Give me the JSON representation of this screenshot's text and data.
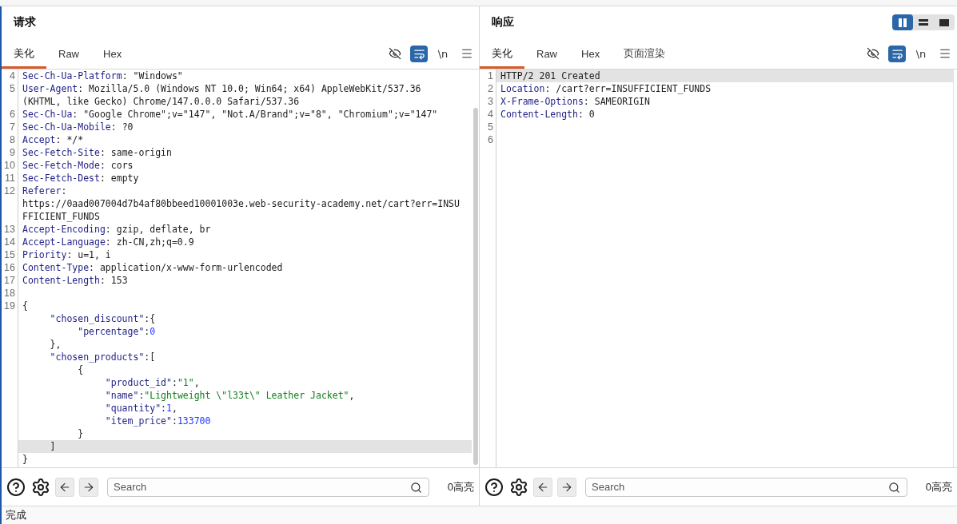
{
  "request": {
    "title": "请求",
    "tabs": [
      {
        "label": "美化",
        "selected": true
      },
      {
        "label": "Raw",
        "selected": false
      },
      {
        "label": "Hex",
        "selected": false
      }
    ],
    "view_toggles": [
      {
        "kind": "hide",
        "selected": false
      },
      {
        "kind": "wrap",
        "selected": true
      },
      {
        "kind": "newline",
        "label": "\\n",
        "selected": false
      }
    ],
    "lines": [
      {
        "number": "4",
        "rows": [
          {
            "current": false,
            "tokens": [
              {
                "kind": "key",
                "text": "Sec-Ch-Ua-Platform"
              },
              {
                "kind": "plain",
                "text": ": \"Windows\""
              }
            ]
          }
        ]
      },
      {
        "number": "5",
        "rows": [
          {
            "current": false,
            "tokens": [
              {
                "kind": "key",
                "text": "User-Agent"
              },
              {
                "kind": "plain",
                "text": ": Mozilla/5.0 (Windows NT 10.0; Win64; x64) AppleWebKit/537.36"
              }
            ]
          },
          {
            "current": false,
            "tokens": [
              {
                "kind": "plain",
                "text": "(KHTML, like Gecko) Chrome/147.0.0.0 Safari/537.36"
              }
            ]
          }
        ]
      },
      {
        "number": "6",
        "rows": [
          {
            "current": false,
            "tokens": [
              {
                "kind": "key",
                "text": "Sec-Ch-Ua"
              },
              {
                "kind": "plain",
                "text": ": \"Google Chrome\";v=\"147\", \"Not.A/Brand\";v=\"8\", \"Chromium\";v=\"147\""
              }
            ]
          }
        ]
      },
      {
        "number": "7",
        "rows": [
          {
            "current": false,
            "tokens": [
              {
                "kind": "key",
                "text": "Sec-Ch-Ua-Mobile"
              },
              {
                "kind": "plain",
                "text": ": ?0"
              }
            ]
          }
        ]
      },
      {
        "number": "8",
        "rows": [
          {
            "current": false,
            "tokens": [
              {
                "kind": "key",
                "text": "Accept"
              },
              {
                "kind": "plain",
                "text": ": */*"
              }
            ]
          }
        ]
      },
      {
        "number": "9",
        "rows": [
          {
            "current": false,
            "tokens": [
              {
                "kind": "key",
                "text": "Sec-Fetch-Site"
              },
              {
                "kind": "plain",
                "text": ": same-origin"
              }
            ]
          }
        ]
      },
      {
        "number": "10",
        "rows": [
          {
            "current": false,
            "tokens": [
              {
                "kind": "key",
                "text": "Sec-Fetch-Mode"
              },
              {
                "kind": "plain",
                "text": ": cors"
              }
            ]
          }
        ]
      },
      {
        "number": "11",
        "rows": [
          {
            "current": false,
            "tokens": [
              {
                "kind": "key",
                "text": "Sec-Fetch-Dest"
              },
              {
                "kind": "plain",
                "text": ": empty"
              }
            ]
          }
        ]
      },
      {
        "number": "12",
        "rows": [
          {
            "current": false,
            "tokens": [
              {
                "kind": "key",
                "text": "Referer"
              },
              {
                "kind": "plain",
                "text": ":"
              }
            ]
          },
          {
            "current": false,
            "tokens": [
              {
                "kind": "plain",
                "text": "https://0aad007004d7b4af80bbeed10001003e.web-security-academy.net/cart?err=INSU"
              }
            ]
          },
          {
            "current": false,
            "tokens": [
              {
                "kind": "plain",
                "text": "FFICIENT_FUNDS"
              }
            ]
          }
        ]
      },
      {
        "number": "13",
        "rows": [
          {
            "current": false,
            "tokens": [
              {
                "kind": "key",
                "text": "Accept-Encoding"
              },
              {
                "kind": "plain",
                "text": ": gzip, deflate, br"
              }
            ]
          }
        ]
      },
      {
        "number": "14",
        "rows": [
          {
            "current": false,
            "tokens": [
              {
                "kind": "key",
                "text": "Accept-Language"
              },
              {
                "kind": "plain",
                "text": ": zh-CN,zh;q=0.9"
              }
            ]
          }
        ]
      },
      {
        "number": "15",
        "rows": [
          {
            "current": false,
            "tokens": [
              {
                "kind": "key",
                "text": "Priority"
              },
              {
                "kind": "plain",
                "text": ": u=1, i"
              }
            ]
          }
        ]
      },
      {
        "number": "16",
        "rows": [
          {
            "current": false,
            "tokens": [
              {
                "kind": "key",
                "text": "Content-Type"
              },
              {
                "kind": "plain",
                "text": ": application/x-www-form-urlencoded"
              }
            ]
          }
        ]
      },
      {
        "number": "17",
        "rows": [
          {
            "current": false,
            "tokens": [
              {
                "kind": "key",
                "text": "Content-Length"
              },
              {
                "kind": "plain",
                "text": ": 153"
              }
            ]
          }
        ]
      },
      {
        "number": "18",
        "rows": [
          {
            "current": false
          }
        ]
      },
      {
        "number": "19",
        "rows": [
          {
            "current": false,
            "tokens": [
              {
                "kind": "plain",
                "text": "{"
              }
            ]
          },
          {
            "current": false,
            "tokens": [
              {
                "kind": "key",
                "text": "     \"chosen_discount\""
              },
              {
                "kind": "plain",
                "text": ":{"
              }
            ]
          },
          {
            "current": false,
            "tokens": [
              {
                "kind": "key",
                "text": "          \"percentage\""
              },
              {
                "kind": "plain",
                "text": ":"
              },
              {
                "kind": "number",
                "text": "0"
              }
            ]
          },
          {
            "current": false,
            "tokens": [
              {
                "kind": "plain",
                "text": "     },"
              }
            ]
          },
          {
            "current": false,
            "tokens": [
              {
                "kind": "key",
                "text": "     \"chosen_products\""
              },
              {
                "kind": "plain",
                "text": ":["
              }
            ]
          },
          {
            "current": false,
            "tokens": [
              {
                "kind": "plain",
                "text": "          {"
              }
            ]
          },
          {
            "current": false,
            "tokens": [
              {
                "kind": "key",
                "text": "               \"product_id\""
              },
              {
                "kind": "plain",
                "text": ":"
              },
              {
                "kind": "string",
                "text": "\"1\""
              },
              {
                "kind": "plain",
                "text": ","
              }
            ]
          },
          {
            "current": false,
            "tokens": [
              {
                "kind": "key",
                "text": "               \"name\""
              },
              {
                "kind": "plain",
                "text": ":"
              },
              {
                "kind": "string",
                "text": "\"Lightweight \\\"l33t\\\" Leather Jacket\""
              },
              {
                "kind": "plain",
                "text": ","
              }
            ]
          },
          {
            "current": false,
            "tokens": [
              {
                "kind": "key",
                "text": "               \"quantity\""
              },
              {
                "kind": "plain",
                "text": ":"
              },
              {
                "kind": "number",
                "text": "1"
              },
              {
                "kind": "plain",
                "text": ","
              }
            ]
          },
          {
            "current": false,
            "tokens": [
              {
                "kind": "key",
                "text": "               \"item_price\""
              },
              {
                "kind": "plain",
                "text": ":"
              },
              {
                "kind": "number",
                "text": "133700"
              }
            ]
          },
          {
            "current": false,
            "tokens": [
              {
                "kind": "plain",
                "text": "          }"
              }
            ]
          },
          {
            "current": true,
            "tokens": [
              {
                "kind": "plain",
                "text": "     ]"
              }
            ]
          },
          {
            "current": false,
            "tokens": [
              {
                "kind": "plain",
                "text": "}"
              }
            ]
          }
        ]
      }
    ],
    "search": {
      "placeholder": "Search"
    },
    "match_count": "0高亮"
  },
  "response": {
    "title": "响应",
    "layout_modes": [
      {
        "kind": "columns",
        "selected": true
      },
      {
        "kind": "rows",
        "selected": false
      },
      {
        "kind": "single",
        "selected": false
      }
    ],
    "tabs": [
      {
        "label": "美化",
        "selected": true
      },
      {
        "label": "Raw",
        "selected": false
      },
      {
        "label": "Hex",
        "selected": false
      },
      {
        "label": "页面渲染",
        "selected": false
      }
    ],
    "view_toggles": [
      {
        "kind": "hide",
        "selected": false
      },
      {
        "kind": "wrap",
        "selected": true
      },
      {
        "kind": "newline",
        "label": "\\n",
        "selected": false
      }
    ],
    "lines": [
      {
        "number": "1",
        "rows": [
          {
            "current": true,
            "tokens": [
              {
                "kind": "plain",
                "text": "HTTP/2 201 Created"
              }
            ]
          }
        ]
      },
      {
        "number": "2",
        "rows": [
          {
            "current": false,
            "tokens": [
              {
                "kind": "key",
                "text": "Location"
              },
              {
                "kind": "plain",
                "text": ": /cart?err=INSUFFICIENT_FUNDS"
              }
            ]
          }
        ]
      },
      {
        "number": "3",
        "rows": [
          {
            "current": false,
            "tokens": [
              {
                "kind": "key",
                "text": "X-Frame-Options"
              },
              {
                "kind": "plain",
                "text": ": SAMEORIGIN"
              }
            ]
          }
        ]
      },
      {
        "number": "4",
        "rows": [
          {
            "current": false,
            "tokens": [
              {
                "kind": "key",
                "text": "Content-Length"
              },
              {
                "kind": "plain",
                "text": ": 0"
              }
            ]
          }
        ]
      },
      {
        "number": "5",
        "rows": [
          {
            "current": false
          }
        ]
      },
      {
        "number": "6",
        "rows": [
          {
            "current": false
          }
        ]
      }
    ],
    "search": {
      "placeholder": "Search"
    },
    "match_count": "0高亮"
  },
  "status_bar": {
    "text": "完成"
  }
}
